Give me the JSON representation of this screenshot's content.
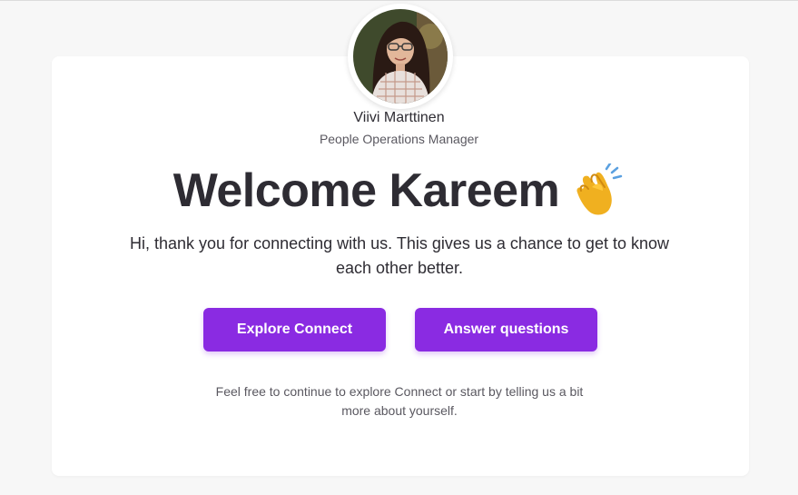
{
  "profile": {
    "name": "Viivi Marttinen",
    "role": "People Operations Manager",
    "avatar_icon": "profile-photo"
  },
  "welcome": {
    "title": "Welcome Kareem",
    "emoji_icon": "clapping-hands-icon",
    "intro": "Hi, thank you for connecting with us. This gives us a chance to get to know each other better."
  },
  "actions": {
    "explore_label": "Explore Connect",
    "answer_label": "Answer questions"
  },
  "footnote": "Feel free to continue to explore Connect or start by telling us a bit more about yourself.",
  "colors": {
    "accent": "#8a2be2",
    "background": "#f7f7f7",
    "card": "#ffffff",
    "text": "#2e2c33"
  }
}
